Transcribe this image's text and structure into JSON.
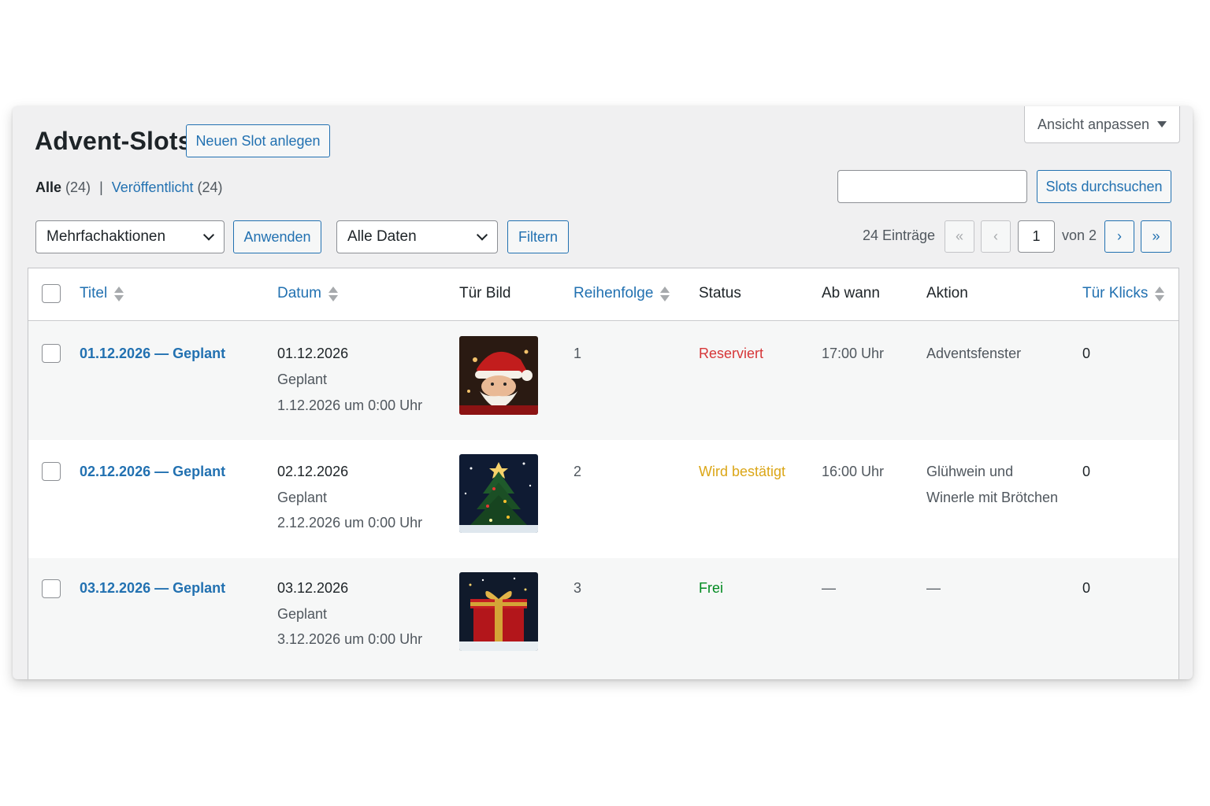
{
  "page": {
    "title": "Advent-Slots",
    "add_new_label": "Neuen Slot anlegen",
    "screen_options_label": "Ansicht anpassen"
  },
  "views": {
    "all_label": "Alle",
    "all_count": "(24)",
    "separator": "|",
    "published_label": "Veröffentlicht",
    "published_count": "(24)"
  },
  "search": {
    "value": "",
    "button_label": "Slots durchsuchen"
  },
  "tablenav": {
    "bulk_select": "Mehrfachaktionen",
    "apply_label": "Anwenden",
    "date_select": "Alle Daten",
    "filter_label": "Filtern",
    "item_count": "24 Einträge",
    "first_page": "«",
    "prev_page": "‹",
    "current_page": "1",
    "of_pages": "von 2",
    "next_page": "›",
    "last_page": "»"
  },
  "columns": {
    "title": "Titel",
    "date": "Datum",
    "image": "Tür Bild",
    "order": "Reihenfolge",
    "status": "Status",
    "from": "Ab wann",
    "action": "Aktion",
    "clicks": "Tür Klicks"
  },
  "rows": [
    {
      "title": "01.12.2026 — Geplant",
      "date": "01.12.2026",
      "state": "Geplant",
      "scheduled": "1.12.2026 um 0:00 Uhr",
      "image_icon": "santa-claus-image",
      "order": "1",
      "status": "Reserviert",
      "status_color": "#d63638",
      "from": "17:00 Uhr",
      "action_line1": "Adventsfenster",
      "action_line2": "",
      "clicks": "0"
    },
    {
      "title": "02.12.2026 — Geplant",
      "date": "02.12.2026",
      "state": "Geplant",
      "scheduled": "2.12.2026 um 0:00 Uhr",
      "image_icon": "christmas-tree-image",
      "order": "2",
      "status": "Wird bestätigt",
      "status_color": "#dba617",
      "from": "16:00 Uhr",
      "action_line1": "Glühwein und",
      "action_line2": "Winerle mit Brötchen",
      "clicks": "0"
    },
    {
      "title": "03.12.2026 — Geplant",
      "date": "03.12.2026",
      "state": "Geplant",
      "scheduled": "3.12.2026 um 0:00 Uhr",
      "image_icon": "gift-box-image",
      "order": "3",
      "status": "Frei",
      "status_color": "#008a20",
      "from": "—",
      "action_line1": "—",
      "action_line2": "",
      "clicks": "0"
    }
  ]
}
